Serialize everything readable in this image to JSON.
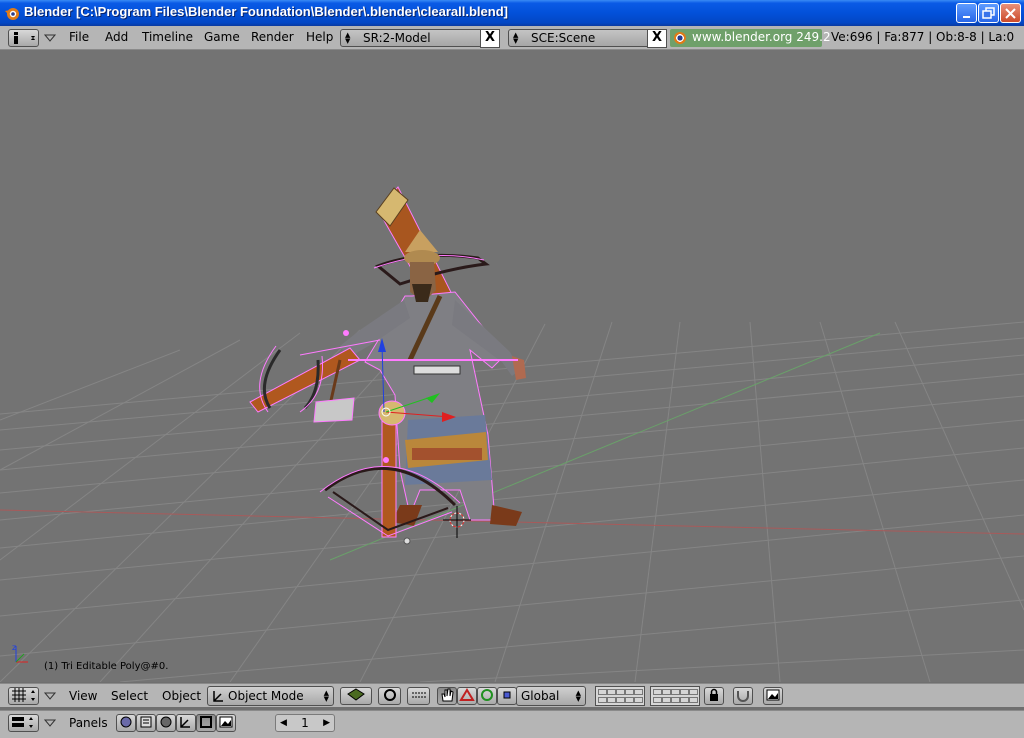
{
  "window": {
    "title": "Blender [C:\\Program Files\\Blender Foundation\\Blender\\.blender\\clearall.blend]"
  },
  "top_header": {
    "menus": [
      "File",
      "Add",
      "Timeline",
      "Game",
      "Render",
      "Help"
    ],
    "screen_field": "SR:2-Model",
    "scene_field": "SCE:Scene",
    "close_glyph": "X",
    "website": "www.blender.org 249.2",
    "stats": "Ve:696 | Fa:877 | Ob:8-8 | La:0"
  },
  "viewport": {
    "object_info": "(1) Tri Editable Poly@#0."
  },
  "view3d_header": {
    "menus": [
      "View",
      "Select",
      "Object"
    ],
    "mode": "Object Mode",
    "orientation": "Global"
  },
  "buttons_header": {
    "panels_label": "Panels",
    "frame": "1"
  },
  "colors": {
    "titlebar": "#0351d9",
    "header": "#b5b5b5",
    "viewport": "#737373",
    "grid": "#8a8a8a",
    "x_axis": "#b04a4a",
    "y_axis": "#5aa05a",
    "selection": "#ff7bff",
    "website_bg": "#6fa06a"
  },
  "icons": [
    "blender-logo-icon",
    "minimize-icon",
    "maximize-icon",
    "close-icon",
    "info-window-icon",
    "view3d-window-icon",
    "buttons-window-icon",
    "hand-icon",
    "lock-icon",
    "render-icon"
  ]
}
